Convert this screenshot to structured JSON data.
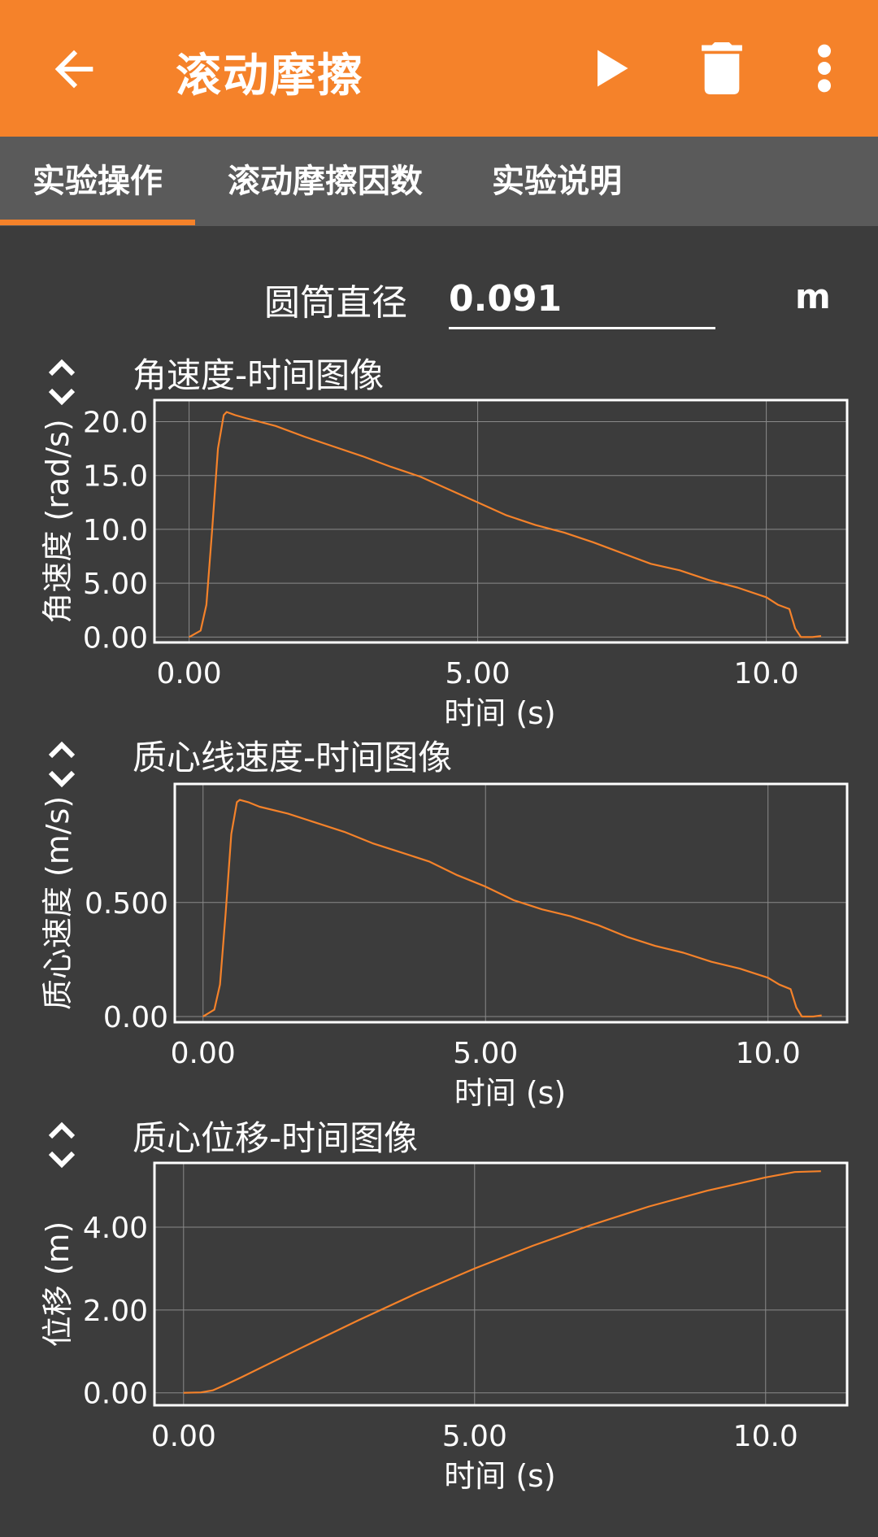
{
  "appbar": {
    "title": "滚动摩擦",
    "icons": [
      "back-arrow-icon",
      "play-icon",
      "trash-icon",
      "more-vert-icon"
    ],
    "color": "#f5822a"
  },
  "tabs": [
    {
      "label": "实验操作",
      "selected": true
    },
    {
      "label": "滚动摩擦因数",
      "selected": false
    },
    {
      "label": "实验说明",
      "selected": false
    }
  ],
  "diameter": {
    "label": "圆筒直径",
    "value": "0.091",
    "unit": "m"
  },
  "chart_data": [
    {
      "type": "line",
      "title": "角速度-时间图像",
      "xlabel": "时间 (s)",
      "ylabel": "角速度 (rad/s)",
      "xlim": [
        -0.6,
        11.4
      ],
      "ylim": [
        -0.5,
        22.0
      ],
      "xticks": [
        0,
        5,
        10
      ],
      "xtick_labels": [
        "0.00",
        "5.00",
        "10.0"
      ],
      "yticks": [
        0,
        5,
        10,
        15,
        20
      ],
      "ytick_labels": [
        "0.00",
        "5.00",
        "10.0",
        "15.0",
        "20.0"
      ],
      "grid": true,
      "color": "#f5822a",
      "x": [
        0.0,
        0.2,
        0.3,
        0.4,
        0.5,
        0.6,
        0.65,
        0.8,
        1.0,
        1.5,
        2.0,
        2.5,
        3.0,
        3.5,
        4.0,
        4.5,
        5.0,
        5.5,
        6.0,
        6.5,
        7.0,
        7.5,
        8.0,
        8.5,
        9.0,
        9.5,
        10.0,
        10.2,
        10.4,
        10.5,
        10.6,
        10.8,
        10.95
      ],
      "y": [
        0.0,
        0.6,
        3.0,
        10.0,
        17.5,
        20.6,
        20.9,
        20.6,
        20.3,
        19.6,
        18.6,
        17.7,
        16.8,
        15.8,
        14.9,
        13.7,
        12.5,
        11.3,
        10.4,
        9.7,
        8.8,
        7.8,
        6.8,
        6.2,
        5.3,
        4.6,
        3.7,
        3.0,
        2.6,
        0.8,
        0.0,
        0.0,
        0.1
      ]
    },
    {
      "type": "line",
      "title": "质心线速度-时间图像",
      "xlabel": "时间 (s)",
      "ylabel": "质心速度 (m/s)",
      "xlim": [
        -0.5,
        11.4
      ],
      "ylim": [
        -0.025,
        1.02
      ],
      "xticks": [
        0,
        5,
        10
      ],
      "xtick_labels": [
        "0.00",
        "5.00",
        "10.0"
      ],
      "yticks": [
        0,
        0.5
      ],
      "ytick_labels": [
        "0.00",
        "0.500"
      ],
      "grid": true,
      "color": "#f5822a",
      "x": [
        0.0,
        0.2,
        0.3,
        0.4,
        0.5,
        0.6,
        0.65,
        0.8,
        1.0,
        1.5,
        2.0,
        2.5,
        3.0,
        3.5,
        4.0,
        4.5,
        5.0,
        5.5,
        6.0,
        6.5,
        7.0,
        7.5,
        8.0,
        8.5,
        9.0,
        9.5,
        10.0,
        10.2,
        10.4,
        10.5,
        10.6,
        10.8,
        10.95
      ],
      "y": [
        0.0,
        0.03,
        0.14,
        0.45,
        0.8,
        0.94,
        0.95,
        0.94,
        0.92,
        0.89,
        0.85,
        0.81,
        0.76,
        0.72,
        0.68,
        0.62,
        0.57,
        0.51,
        0.47,
        0.44,
        0.4,
        0.35,
        0.31,
        0.28,
        0.24,
        0.21,
        0.17,
        0.14,
        0.12,
        0.04,
        0.0,
        0.0,
        0.005
      ]
    },
    {
      "type": "line",
      "title": "质心位移-时间图像",
      "xlabel": "时间 (s)",
      "ylabel": "位移 (m)",
      "xlim": [
        -0.5,
        11.4
      ],
      "ylim": [
        -0.3,
        5.55
      ],
      "xticks": [
        0,
        5,
        10
      ],
      "xtick_labels": [
        "0.00",
        "5.00",
        "10.0"
      ],
      "yticks": [
        0,
        2,
        4
      ],
      "ytick_labels": [
        "0.00",
        "2.00",
        "4.00"
      ],
      "grid": true,
      "color": "#f5822a",
      "x": [
        0.0,
        0.3,
        0.5,
        0.7,
        1.0,
        2.0,
        3.0,
        4.0,
        5.0,
        6.0,
        7.0,
        8.0,
        9.0,
        10.0,
        10.5,
        10.95
      ],
      "y": [
        0.0,
        0.01,
        0.06,
        0.18,
        0.38,
        1.07,
        1.75,
        2.4,
        3.0,
        3.55,
        4.05,
        4.5,
        4.88,
        5.2,
        5.33,
        5.35
      ]
    }
  ]
}
